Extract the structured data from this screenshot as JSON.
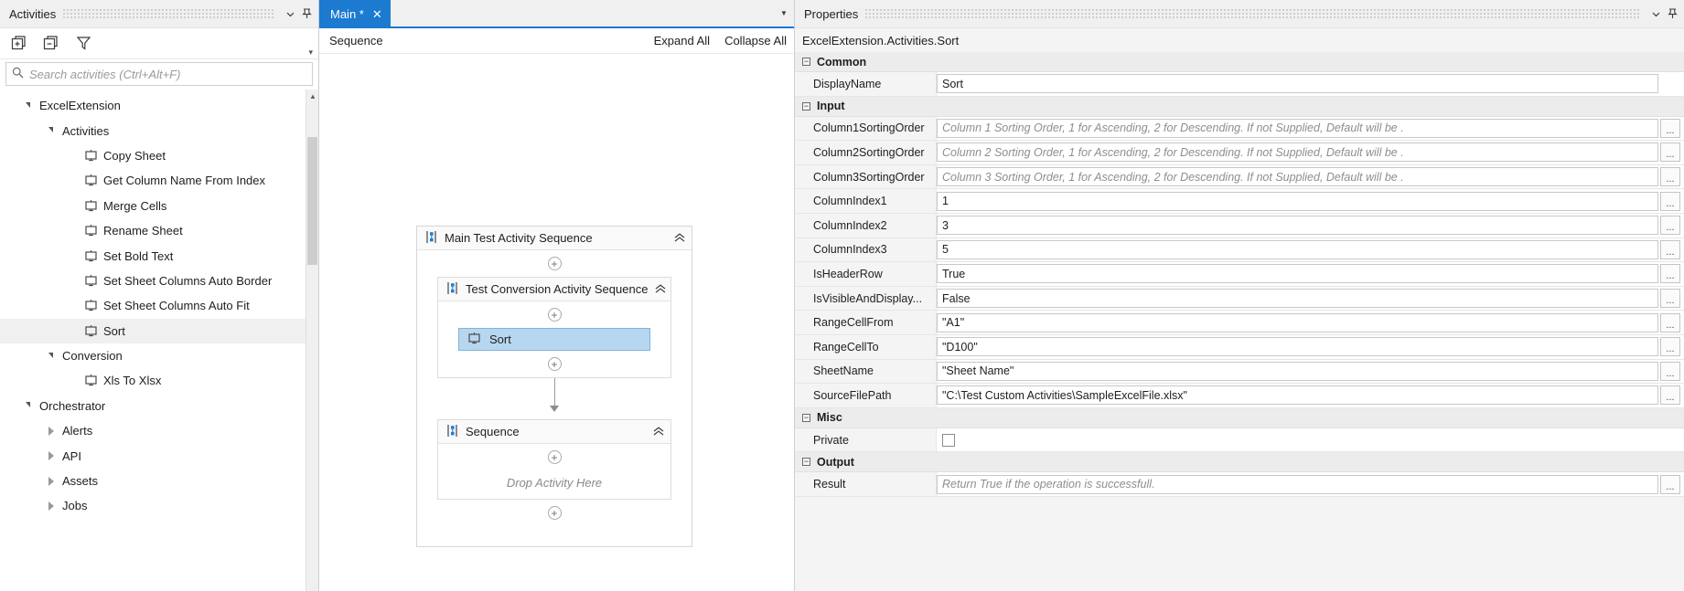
{
  "activities": {
    "caption": "Activities",
    "caption_icons": [
      "chevron-down-icon",
      "pin-icon"
    ],
    "toolbar": [
      {
        "name": "expand-all-icon",
        "label": "Expand All"
      },
      {
        "name": "collapse-all-icon",
        "label": "Collapse All"
      },
      {
        "name": "filter-icon",
        "label": "Filter"
      }
    ],
    "search": {
      "placeholder": "Search activities (Ctrl+Alt+F)",
      "value": ""
    },
    "tree": [
      {
        "label": "ExcelExtension",
        "indent": 0,
        "state": "expanded",
        "type": "folder",
        "selected": false
      },
      {
        "label": "Activities",
        "indent": 1,
        "state": "expanded",
        "type": "folder",
        "selected": false
      },
      {
        "label": "Copy Sheet",
        "indent": 2,
        "state": "leaf",
        "type": "activity",
        "selected": false
      },
      {
        "label": "Get Column Name From Index",
        "indent": 2,
        "state": "leaf",
        "type": "activity",
        "selected": false
      },
      {
        "label": "Merge Cells",
        "indent": 2,
        "state": "leaf",
        "type": "activity",
        "selected": false
      },
      {
        "label": "Rename Sheet",
        "indent": 2,
        "state": "leaf",
        "type": "activity",
        "selected": false
      },
      {
        "label": "Set Bold Text",
        "indent": 2,
        "state": "leaf",
        "type": "activity",
        "selected": false
      },
      {
        "label": "Set Sheet Columns Auto Border",
        "indent": 2,
        "state": "leaf",
        "type": "activity",
        "selected": false
      },
      {
        "label": "Set Sheet Columns Auto Fit",
        "indent": 2,
        "state": "leaf",
        "type": "activity",
        "selected": false
      },
      {
        "label": "Sort",
        "indent": 2,
        "state": "leaf",
        "type": "activity",
        "selected": true
      },
      {
        "label": "Conversion",
        "indent": 1,
        "state": "expanded",
        "type": "folder",
        "selected": false
      },
      {
        "label": "Xls To Xlsx",
        "indent": 2,
        "state": "leaf",
        "type": "activity",
        "selected": false
      },
      {
        "label": "Orchestrator",
        "indent": 0,
        "state": "expanded",
        "type": "folder",
        "selected": false
      },
      {
        "label": "Alerts",
        "indent": 1,
        "state": "collapsed",
        "type": "folder",
        "selected": false
      },
      {
        "label": "API",
        "indent": 1,
        "state": "collapsed",
        "type": "folder",
        "selected": false
      },
      {
        "label": "Assets",
        "indent": 1,
        "state": "collapsed",
        "type": "folder",
        "selected": false
      },
      {
        "label": "Jobs",
        "indent": 1,
        "state": "collapsed",
        "type": "folder",
        "selected": false
      }
    ]
  },
  "designer": {
    "tab": {
      "label": "Main *",
      "close": "✕"
    },
    "breadcrumb": "Sequence",
    "expand_all": "Expand All",
    "collapse_all": "Collapse All",
    "workflow": {
      "outer_title": "Main Test Activity Sequence",
      "inner_title": "Test  Conversion Activity Sequence",
      "activity_label": "Sort",
      "second_title": "Sequence",
      "drop_hint": "Drop Activity Here",
      "plus_glyph": "+",
      "collapse_glyph": "»",
      "selected_activity_bg": "#b7d7f0"
    }
  },
  "properties": {
    "caption": "Properties",
    "type_name": "ExcelExtension.Activities.Sort",
    "groups": [
      {
        "name": "Common",
        "rows": [
          {
            "name": "DisplayName",
            "value": "Sort",
            "placeholder": "",
            "kind": "text",
            "ellipsis": false
          }
        ]
      },
      {
        "name": "Input",
        "rows": [
          {
            "name": "Column1SortingOrder",
            "value": "",
            "placeholder": "Column 1 Sorting Order, 1 for Ascending, 2 for Descending. If not Supplied, Default will be .",
            "kind": "text",
            "ellipsis": true
          },
          {
            "name": "Column2SortingOrder",
            "value": "",
            "placeholder": "Column 2 Sorting Order, 1 for Ascending, 2 for Descending. If not Supplied, Default will be .",
            "kind": "text",
            "ellipsis": true
          },
          {
            "name": "Column3SortingOrder",
            "value": "",
            "placeholder": "Column 3 Sorting Order, 1 for Ascending, 2 for Descending. If not Supplied, Default will be .",
            "kind": "text",
            "ellipsis": true
          },
          {
            "name": "ColumnIndex1",
            "value": "1",
            "placeholder": "",
            "kind": "text",
            "ellipsis": true
          },
          {
            "name": "ColumnIndex2",
            "value": "3",
            "placeholder": "",
            "kind": "text",
            "ellipsis": true
          },
          {
            "name": "ColumnIndex3",
            "value": "5",
            "placeholder": "",
            "kind": "text",
            "ellipsis": true
          },
          {
            "name": "IsHeaderRow",
            "value": "True",
            "placeholder": "",
            "kind": "text",
            "ellipsis": true
          },
          {
            "name": "IsVisibleAndDisplay...",
            "value": "False",
            "placeholder": "",
            "kind": "text",
            "ellipsis": true
          },
          {
            "name": "RangeCellFrom",
            "value": "\"A1\"",
            "placeholder": "",
            "kind": "text",
            "ellipsis": true
          },
          {
            "name": "RangeCellTo",
            "value": "\"D100\"",
            "placeholder": "",
            "kind": "text",
            "ellipsis": true
          },
          {
            "name": "SheetName",
            "value": "\"Sheet Name\"",
            "placeholder": "",
            "kind": "text",
            "ellipsis": true
          },
          {
            "name": "SourceFilePath",
            "value": "\"C:\\Test Custom Activities\\SampleExcelFile.xlsx\"",
            "placeholder": "",
            "kind": "text",
            "ellipsis": true
          }
        ]
      },
      {
        "name": "Misc",
        "rows": [
          {
            "name": "Private",
            "value": "",
            "placeholder": "",
            "kind": "checkbox",
            "checked": false,
            "ellipsis": false
          }
        ]
      },
      {
        "name": "Output",
        "rows": [
          {
            "name": "Result",
            "value": "",
            "placeholder": "Return True if the operation is successfull.",
            "kind": "text",
            "ellipsis": true
          }
        ]
      }
    ],
    "collapse_glyph": "−",
    "ellipsis_label": "..."
  },
  "theme": {
    "accent": "#1c7ad1",
    "panel_bg": "#f0f0f0",
    "selection": "#b7d7f0",
    "row_alt": "#f4f4f4"
  }
}
